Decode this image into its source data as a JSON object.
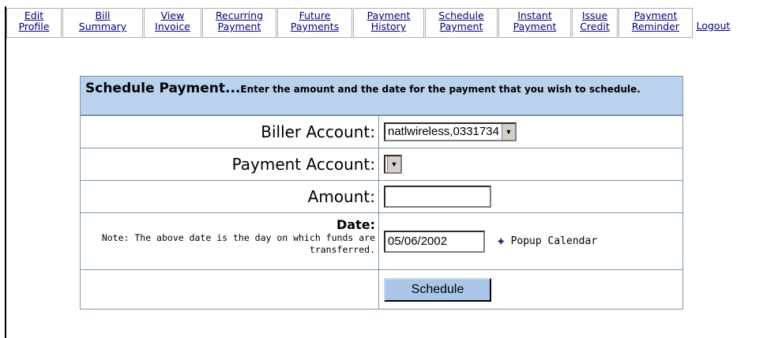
{
  "nav": {
    "items": [
      {
        "line1": "Edit",
        "line2": "Profile"
      },
      {
        "line1": "Bill",
        "line2": "Summary"
      },
      {
        "line1": "View",
        "line2": "Invoice"
      },
      {
        "line1": "Recurring",
        "line2": "Payment"
      },
      {
        "line1": "Future",
        "line2": "Payments"
      },
      {
        "line1": "Payment",
        "line2": "History"
      },
      {
        "line1": "Schedule",
        "line2": "Payment"
      },
      {
        "line1": "Instant",
        "line2": "Payment"
      },
      {
        "line1": "Issue",
        "line2": "Credit"
      },
      {
        "line1": "Payment",
        "line2": "Reminder"
      }
    ],
    "logout": "Logout"
  },
  "form": {
    "title": "Schedule Payment...",
    "subtitle": "Enter the amount and the date for the payment that you wish to schedule.",
    "biller_label": "Biller Account:",
    "biller_value": "natlwireless,0331734",
    "payment_account_label": "Payment Account:",
    "payment_account_value": "",
    "amount_label": "Amount:",
    "amount_value": "",
    "date_label": "Date:",
    "date_note": "Note: The above date is the day on which funds are transferred.",
    "date_value": "05/06/2002",
    "calendar_link": "Popup Calendar",
    "schedule_button": "Schedule"
  }
}
